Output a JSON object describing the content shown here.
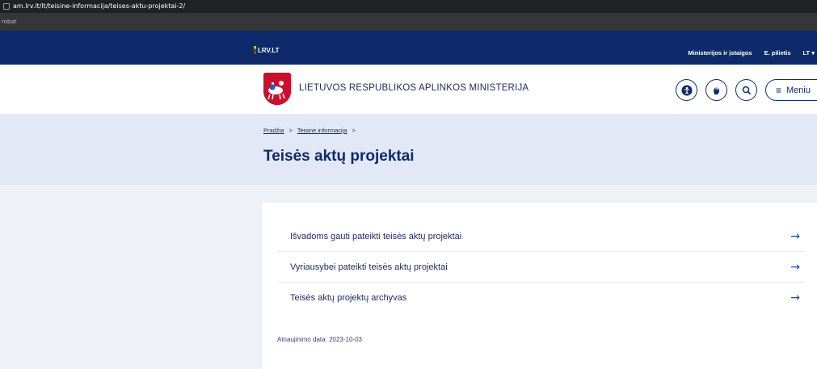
{
  "browser": {
    "url": "am.lrv.lt/lt/teisine-informacija/teises-aktu-projektai-2/",
    "bookmark": "robat"
  },
  "topnav": {
    "logo": "LRV.LT",
    "links": [
      "Ministerijos ir įstaigos",
      "E. pilietis"
    ],
    "language": "LT"
  },
  "header": {
    "ministry": "LIETUVOS RESPUBLIKOS APLINKOS MINISTERIJA",
    "menu_label": "Meniu"
  },
  "breadcrumb": {
    "items": [
      "Pradžia",
      "Teisinė informacija"
    ],
    "separator": ">"
  },
  "page": {
    "title": "Teisės aktų projektai"
  },
  "links": [
    {
      "label": "Išvadoms gauti pateikti teisės aktų projektai",
      "arrow": "→"
    },
    {
      "label": "Vyriausybei pateikti teisės aktų projektai",
      "arrow": "→"
    },
    {
      "label": "Teisės aktų projektų archyvas",
      "arrow": "→"
    }
  ],
  "footer": {
    "update_label": "Atnaujinimo data:",
    "update_date": "2023-10-03"
  },
  "colors": {
    "navy": "#0e2a6b",
    "hero_bg": "#e2e8f6",
    "coat_red": "#c8102e"
  }
}
